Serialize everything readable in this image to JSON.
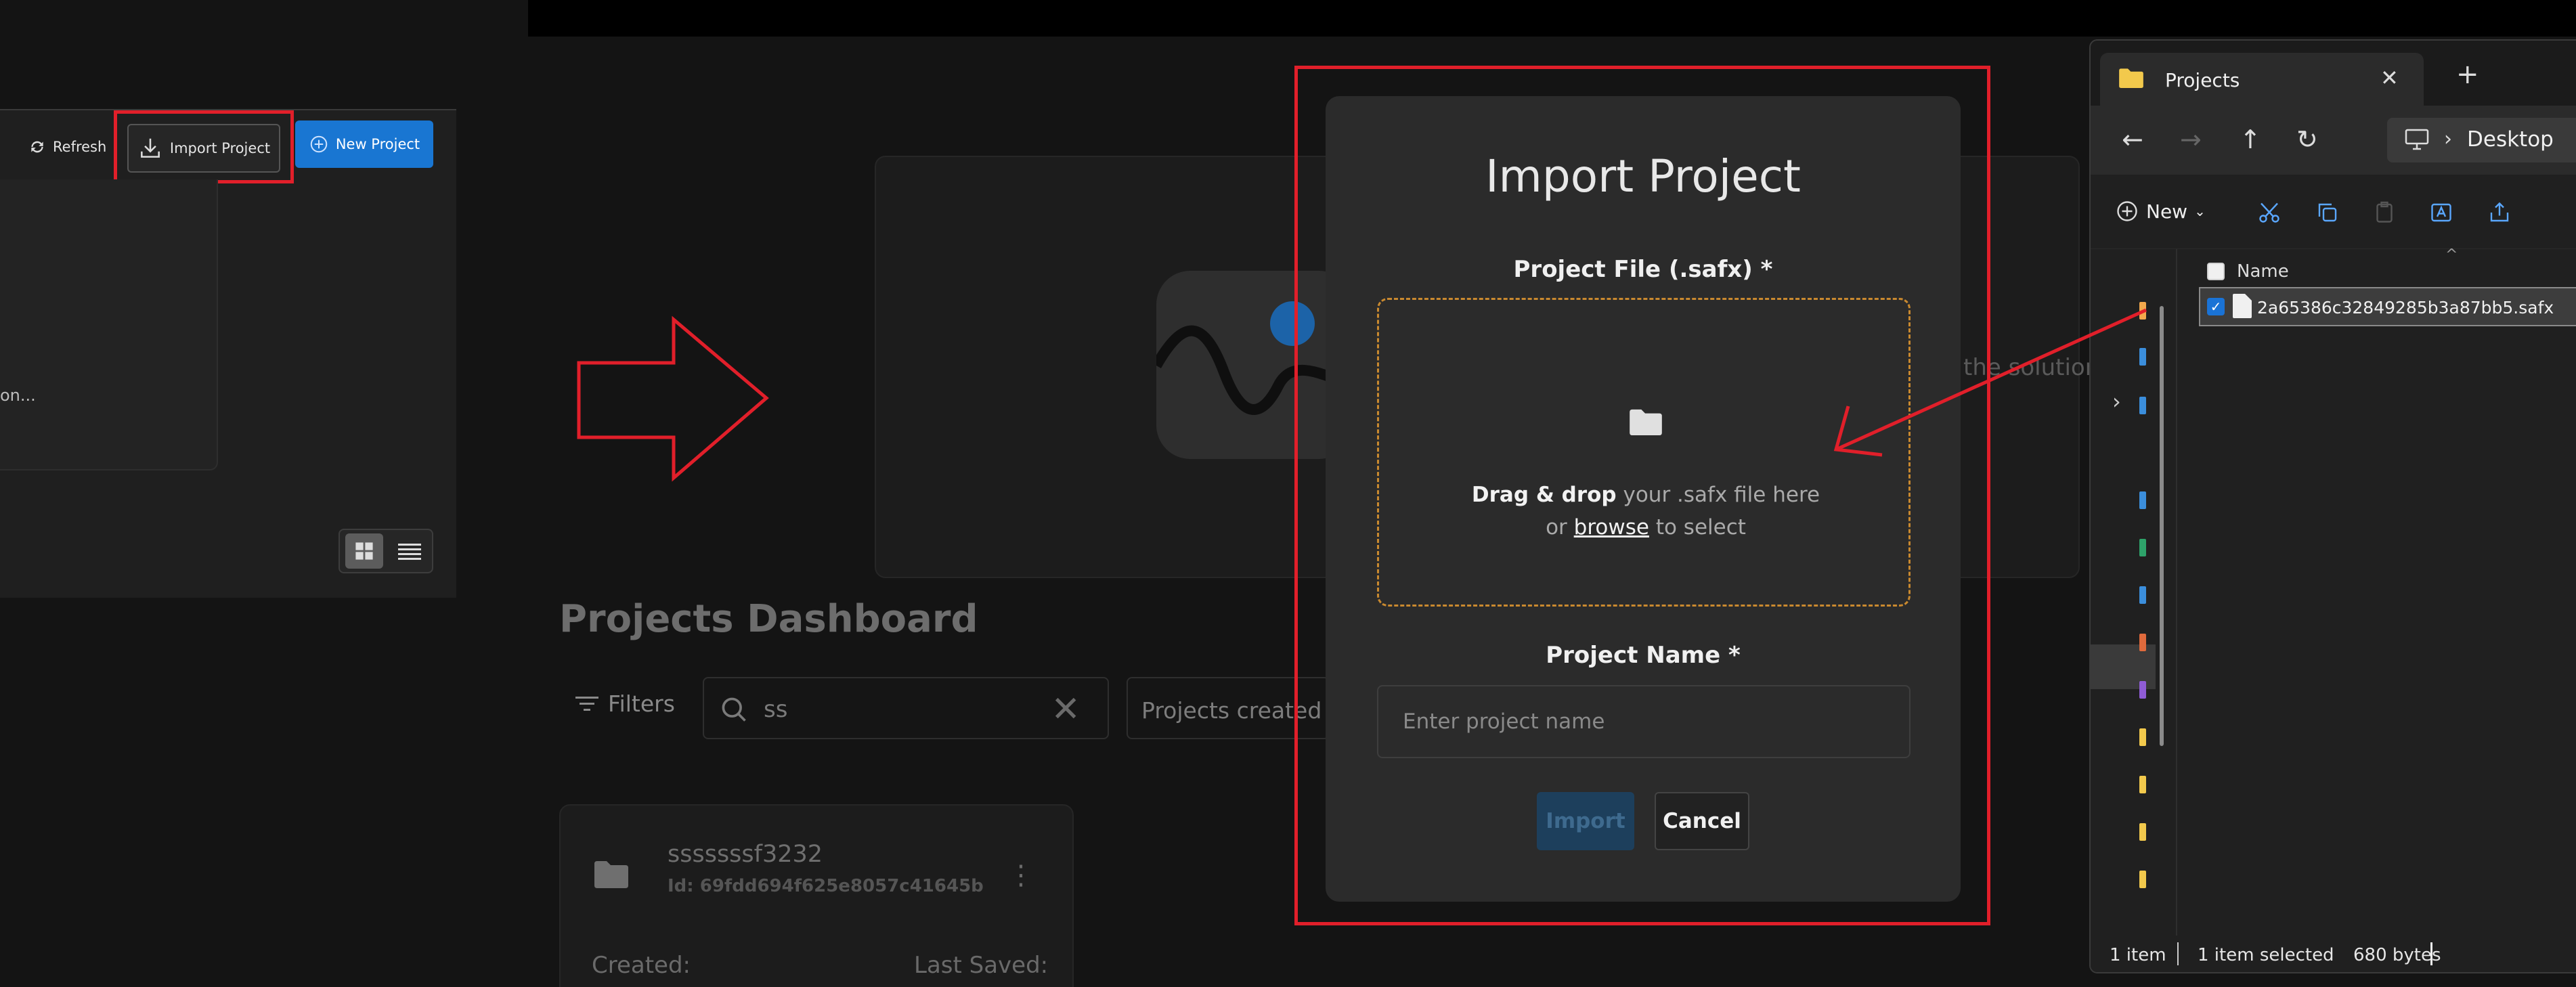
{
  "left_toolbar": {
    "refresh_label": "Refresh",
    "import_label": "Import Project",
    "new_project_label": "New Project",
    "card_text": "on..."
  },
  "hero": {
    "text": "the solution"
  },
  "dashboard": {
    "title": "Projects Dashboard",
    "filters_label": "Filters",
    "search_value": "ss",
    "sort_label": "Projects created",
    "project": {
      "name": "sssssssf3232",
      "id": "Id: 69fdd694f625e8057c41645b",
      "created_label": "Created:",
      "saved_label": "Last Saved:"
    }
  },
  "modal": {
    "title": "Import Project",
    "file_label": "Project File (.safx) *",
    "drop_bold": "Drag & drop",
    "drop_rest": " your .safx file here",
    "drop_or": "or ",
    "drop_browse": "browse",
    "drop_select": " to select",
    "name_label": "Project Name *",
    "name_placeholder": "Enter project name",
    "import_button": "Import",
    "cancel_button": "Cancel"
  },
  "explorer": {
    "tab_title": "Projects",
    "address": "Desktop",
    "new_label": "New",
    "column_name": "Name",
    "file_name": "2a65386c32849285b3a87bb5.safx",
    "status_count": "1 item",
    "status_selected": "1 item selected",
    "status_size": "680 bytes"
  },
  "colors": {
    "annotation_red": "#e11f2a",
    "primary_blue": "#1976d2",
    "dropzone_border": "#c9892f",
    "modal_bg": "#2b2b2b"
  }
}
